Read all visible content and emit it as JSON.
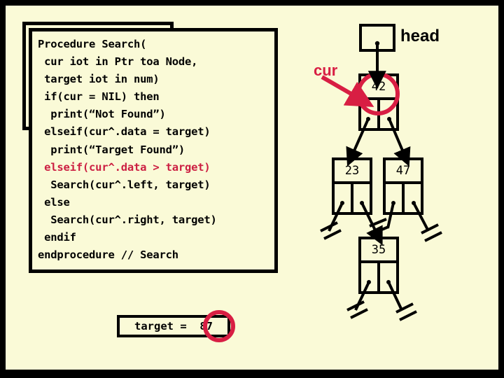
{
  "slide": {
    "background_color": "#FAFAD7",
    "border_color": "#000000",
    "accent_red": "#D81E43"
  },
  "code_card": {
    "lines": [
      {
        "text": "Procedure Search(",
        "highlight": false
      },
      {
        "text": " cur iot in Ptr toa Node,",
        "highlight": false
      },
      {
        "text": " target iot in num)",
        "highlight": false
      },
      {
        "text": " if(cur = NIL) then",
        "highlight": false
      },
      {
        "text": "  print(“Not Found”)",
        "highlight": false
      },
      {
        "text": " elseif(cur^.data = target)",
        "highlight": false
      },
      {
        "text": "  print(“Target Found”)",
        "highlight": false
      },
      {
        "text": " elseif(cur^.data > target)",
        "highlight": true
      },
      {
        "text": "  Search(cur^.left, target)",
        "highlight": false
      },
      {
        "text": " else",
        "highlight": false
      },
      {
        "text": "  Search(cur^.right, target)",
        "highlight": false
      },
      {
        "text": " endif",
        "highlight": false
      },
      {
        "text": "endprocedure // Search",
        "highlight": false
      }
    ]
  },
  "target_box": {
    "text": "target =  87",
    "variable": "target",
    "value": "87",
    "circled": true
  },
  "tree": {
    "head_label": "head",
    "cur_label": "cur",
    "nodes": [
      {
        "value": "42",
        "circled": true,
        "name": "node-42"
      },
      {
        "value": "23",
        "circled": false,
        "name": "node-23"
      },
      {
        "value": "47",
        "circled": false,
        "name": "node-47"
      },
      {
        "value": "35",
        "circled": false,
        "name": "node-35"
      }
    ],
    "nil_count": 5
  }
}
